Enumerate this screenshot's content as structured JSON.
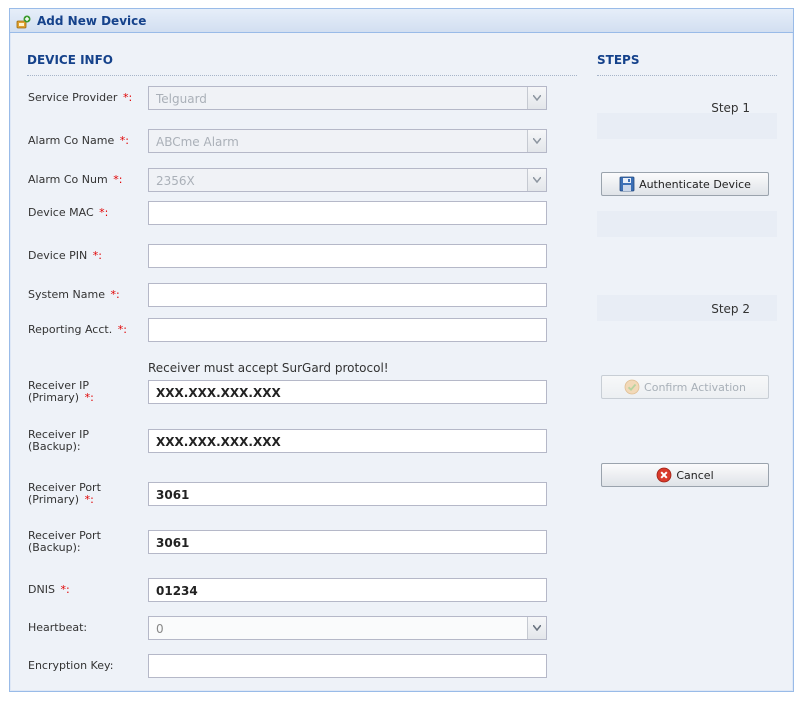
{
  "window": {
    "title": "Add New Device"
  },
  "device_info": {
    "heading": "DEVICE INFO",
    "required_marker": "*:",
    "fields": {
      "service_provider": {
        "label": "Service Provider",
        "value": "Telguard"
      },
      "alarm_co_name": {
        "label": "Alarm Co Name",
        "value": "ABCme Alarm"
      },
      "alarm_co_num": {
        "label": "Alarm Co Num",
        "value": "2356X"
      },
      "device_mac": {
        "label": "Device MAC",
        "value": ""
      },
      "device_pin": {
        "label": "Device PIN",
        "value": ""
      },
      "system_name": {
        "label": "System Name",
        "value": ""
      },
      "reporting_acct": {
        "label": "Reporting Acct.",
        "value": ""
      },
      "receiver_ip_primary": {
        "label_line1": "Receiver IP",
        "label_line2": "(Primary)",
        "value": "XXX.XXX.XXX.XXX"
      },
      "receiver_ip_backup": {
        "label_line1": "Receiver IP",
        "label_line2": "(Backup):",
        "value": "XXX.XXX.XXX.XXX"
      },
      "receiver_port_primary": {
        "label_line1": "Receiver Port",
        "label_line2": "(Primary)",
        "value": "3061"
      },
      "receiver_port_backup": {
        "label_line1": "Receiver Port",
        "label_line2": "(Backup):",
        "value": "3061"
      },
      "dnis": {
        "label": "DNIS",
        "value": "01234"
      },
      "heartbeat": {
        "label": "Heartbeat:",
        "value": "0"
      },
      "encryption_key": {
        "label": "Encryption Key:",
        "value": ""
      }
    },
    "note": "Receiver must accept SurGard protocol!"
  },
  "steps": {
    "heading": "STEPS",
    "step1": "Step 1",
    "step2": "Step 2",
    "authenticate_button": "Authenticate Device",
    "confirm_button": "Confirm Activation",
    "cancel_button": "Cancel"
  },
  "colors": {
    "heading": "#15428b",
    "required": "#e00000",
    "window_border": "#99bbe8"
  },
  "icons": [
    "add-device-icon",
    "dropdown-arrow-icon",
    "save-icon",
    "confirm-icon",
    "cancel-icon"
  ]
}
